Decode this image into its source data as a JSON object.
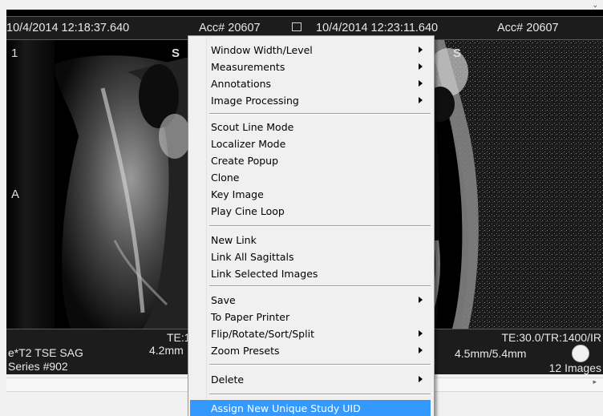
{
  "left_pane": {
    "datetime": "10/4/2014 12:18:37.640",
    "accession": "Acc# 20607",
    "image_index": "1",
    "orient_top": "S",
    "orient_left": "A",
    "te_label": "TE:1",
    "thickness": "4.2mm",
    "series_desc": "e*T2 TSE SAG",
    "series_number": "Series #902"
  },
  "right_pane": {
    "datetime": "10/4/2014 12:23:11.640",
    "accession": "Acc# 20607",
    "orient_top": "S",
    "te_tr": "TE:30.0/TR:1400/IR",
    "thickness": "4.5mm/5.4mm",
    "image_count": "12 Images"
  },
  "context_menu": {
    "groups": [
      [
        {
          "label": "Window Width/Level",
          "submenu": true
        },
        {
          "label": "Measurements",
          "submenu": true
        },
        {
          "label": "Annotations",
          "submenu": true
        },
        {
          "label": "Image Processing",
          "submenu": true
        }
      ],
      [
        {
          "label": "Scout Line Mode",
          "submenu": false
        },
        {
          "label": "Localizer Mode",
          "submenu": false
        },
        {
          "label": "Create Popup",
          "submenu": false
        },
        {
          "label": "Clone",
          "submenu": false
        },
        {
          "label": "Key Image",
          "submenu": false
        },
        {
          "label": "Play Cine Loop",
          "submenu": false
        }
      ],
      [
        {
          "label": "New Link",
          "submenu": false
        },
        {
          "label": "Link All Sagittals",
          "submenu": false
        },
        {
          "label": "Link Selected Images",
          "submenu": false
        }
      ],
      [
        {
          "label": "Save",
          "submenu": true
        },
        {
          "label": "To Paper Printer",
          "submenu": false
        },
        {
          "label": "Flip/Rotate/Sort/Split",
          "submenu": true
        },
        {
          "label": "Zoom Presets",
          "submenu": true
        }
      ],
      [
        {
          "label": "Delete",
          "submenu": true
        }
      ],
      [
        {
          "label": "Assign New Unique Study UID",
          "submenu": false,
          "highlighted": true
        }
      ]
    ]
  },
  "colors": {
    "highlight": "#3399ff",
    "viewport_bg": "#000000",
    "overlay_bar": "#1c1c1c",
    "menu_bg": "#f0f0f0"
  },
  "icons": {
    "menu_toggle": "window-menu-icon",
    "cine_indicator": "circle-icon",
    "submenu": "triangle-right-icon"
  }
}
